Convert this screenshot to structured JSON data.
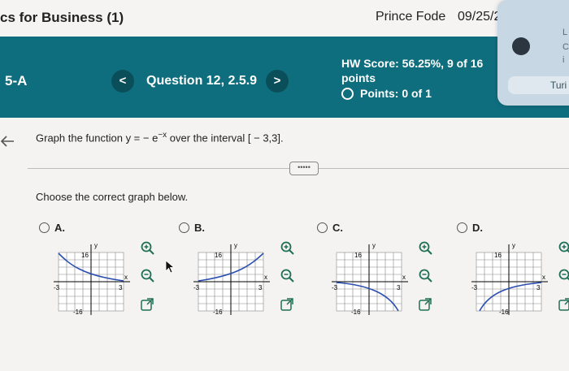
{
  "topbar": {
    "course": "cs for Business (1)",
    "student": "Prince Fode",
    "date": "09/25/2"
  },
  "header": {
    "hw_id": "5-A",
    "prev": "<",
    "next": ">",
    "question": "Question 12, 2.5.9",
    "score_line1": "HW Score: 56.25%, 9 of 16",
    "score_line2": "points",
    "points": "Points: 0 of 1"
  },
  "popup": {
    "t1": "L",
    "t2": "C",
    "t3": "i",
    "turn": "Turi"
  },
  "question": {
    "prompt_prefix": "Graph the function y = − e",
    "prompt_exp": "−x",
    "prompt_suffix": " over the interval [ − 3,3].",
    "more": "•••••",
    "choose": "Choose the correct graph below."
  },
  "options": [
    {
      "letter": "A."
    },
    {
      "letter": "B."
    },
    {
      "letter": "C."
    },
    {
      "letter": "D."
    }
  ],
  "graph_labels": {
    "y": "y",
    "x": "x",
    "ytop": "16",
    "ybot": "-16",
    "xleft": "-3",
    "xright": "3"
  },
  "colors": {
    "header": "#0f6e7e",
    "curve": "#2b4fb0",
    "icon": "#1f6f56"
  }
}
